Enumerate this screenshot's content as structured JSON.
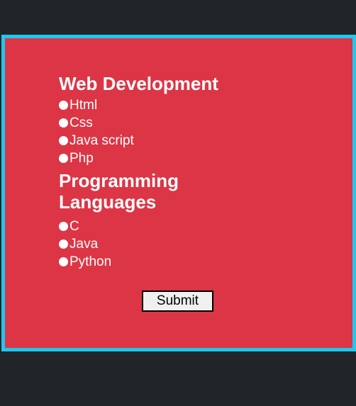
{
  "form": {
    "section1": {
      "title": "Web Development",
      "options": [
        "Html",
        "Css",
        "Java script",
        "Php"
      ]
    },
    "section2": {
      "title_line1": "Programming",
      "title_line2": "Languages",
      "options": [
        "C",
        "Java",
        "Python"
      ]
    },
    "submit_label": "Submit"
  },
  "colors": {
    "background": "#212529",
    "panel": "#dc3545",
    "panel_border": "#1fc8ef",
    "text": "#ffffff"
  }
}
